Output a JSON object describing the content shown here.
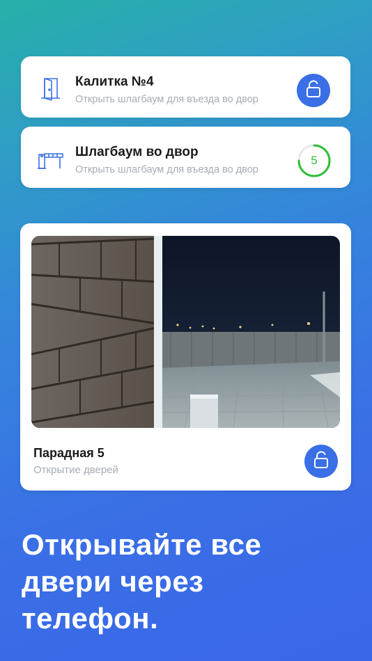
{
  "actions": [
    {
      "title": "Калитка №4",
      "subtitle": "Открыть шлагбаум для въезда во двор",
      "icon": "door-icon",
      "control": "lock-icon"
    },
    {
      "title": "Шлагбаум во двор",
      "subtitle": "Открыть шлагбаум для въезда во двор",
      "icon": "barrier-icon",
      "control": "countdown-timer",
      "timer_value": "5"
    }
  ],
  "camera": {
    "title": "Парадная 5",
    "subtitle": "Открытие  дверей",
    "control": "lock-icon"
  },
  "headline": {
    "line1": "Открывайте все",
    "line2": "двери через",
    "line3": "телефон."
  },
  "colors": {
    "accent": "#3a6fe6",
    "timer": "#2fbf3a",
    "background_top": "#27b0a8",
    "background_bottom": "#3a66e8"
  }
}
